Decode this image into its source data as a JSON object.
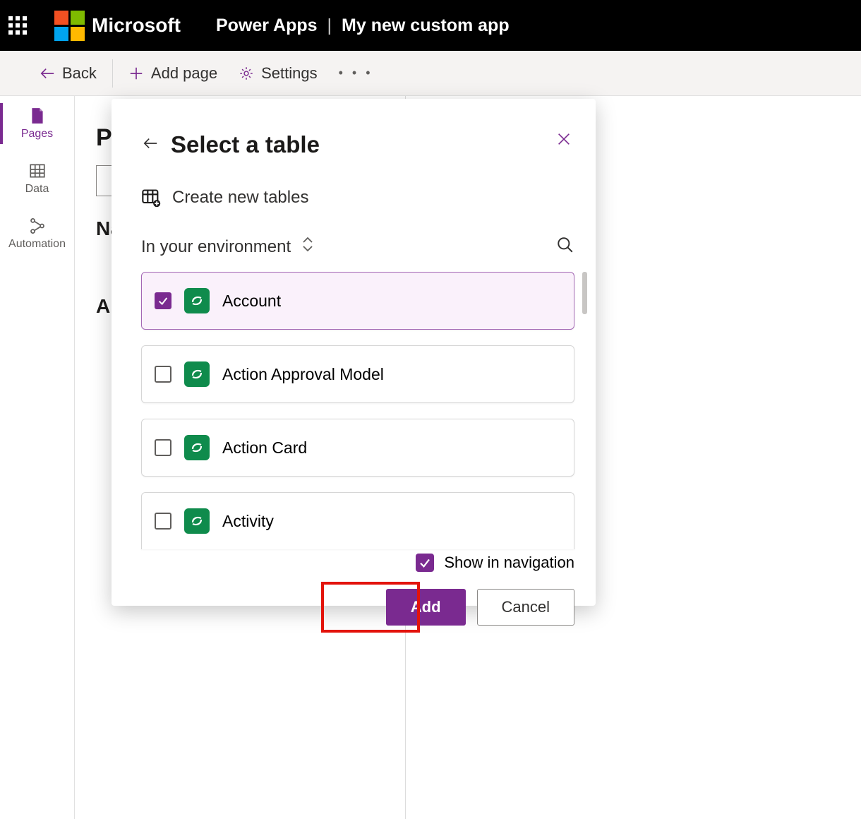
{
  "topbar": {
    "vendor": "Microsoft",
    "product": "Power Apps",
    "app_name": "My new custom app"
  },
  "toolbar": {
    "back": "Back",
    "add_page": "Add page",
    "settings": "Settings"
  },
  "leftrail": {
    "items": [
      {
        "label": "Pages"
      },
      {
        "label": "Data"
      },
      {
        "label": "Automation"
      }
    ]
  },
  "background": {
    "pages_header_fragment": "Pa",
    "name_header_fragment": "Na",
    "all_header_fragment": "Al"
  },
  "modal": {
    "title": "Select a table",
    "create_new": "Create new tables",
    "env_label": "In your environment",
    "tables": [
      {
        "name": "Account",
        "checked": true
      },
      {
        "name": "Action Approval Model",
        "checked": false
      },
      {
        "name": "Action Card",
        "checked": false
      },
      {
        "name": "Activity",
        "checked": false
      }
    ],
    "show_in_nav": "Show in navigation",
    "add": "Add",
    "cancel": "Cancel"
  }
}
